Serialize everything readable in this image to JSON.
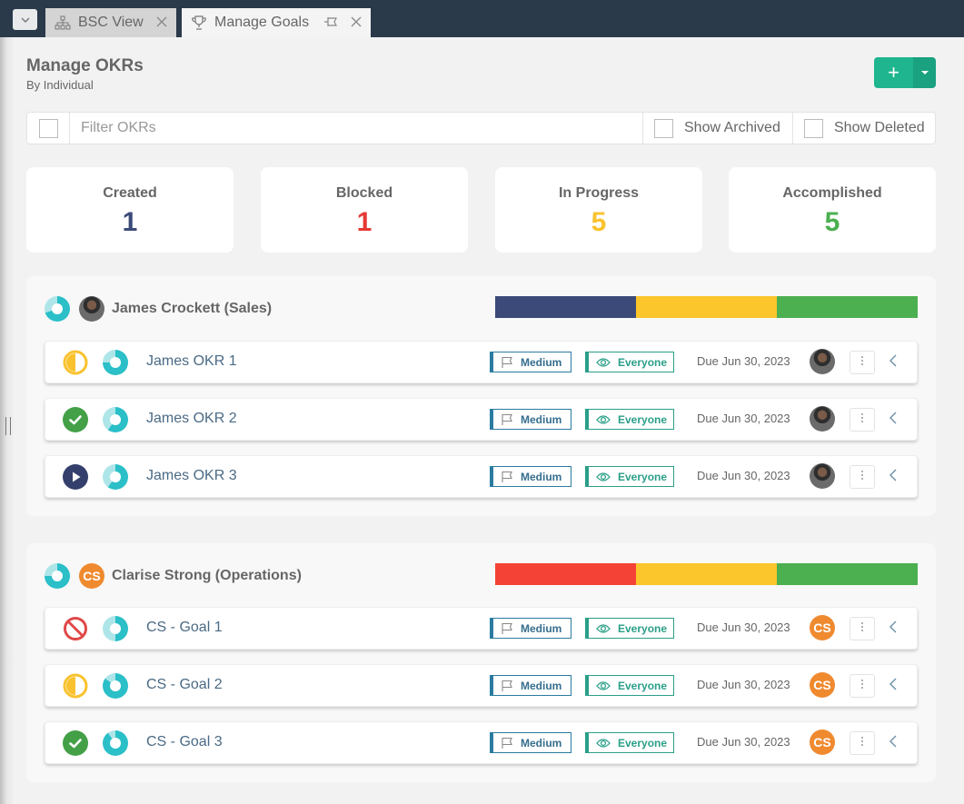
{
  "tabs": [
    {
      "label": "BSC View",
      "icon": "org-chart-icon",
      "active": false
    },
    {
      "label": "Manage Goals",
      "icon": "trophy-icon",
      "active": true
    }
  ],
  "header": {
    "title": "Manage OKRs",
    "subtitle": "By Individual",
    "add_label": "+"
  },
  "filter": {
    "placeholder": "Filter OKRs",
    "value": "",
    "show_archived_label": "Show Archived",
    "show_deleted_label": "Show Deleted"
  },
  "colors": {
    "created": "#3b4a78",
    "blocked": "#e53935",
    "in_progress": "#f9c22e",
    "accomplished": "#4caf50",
    "accent": "#1fb58e",
    "ring": "#2bbfc8",
    "ring_light": "#aee5e8"
  },
  "stats": [
    {
      "label": "Created",
      "value": "1",
      "color": "#3b4a78"
    },
    {
      "label": "Blocked",
      "value": "1",
      "color": "#e53935"
    },
    {
      "label": "In Progress",
      "value": "5",
      "color": "#f9c22e"
    },
    {
      "label": "Accomplished",
      "value": "5",
      "color": "#4caf50"
    }
  ],
  "groups": [
    {
      "name": "James Crockett (Sales)",
      "avatar_type": "photo",
      "avatar_initials": "",
      "progress_fraction": 0.7,
      "status_bar": [
        {
          "status": "created",
          "fraction": 0.3333,
          "color": "#3b4a78"
        },
        {
          "status": "in_progress",
          "fraction": 0.3333,
          "color": "#fbc52c"
        },
        {
          "status": "accomplished",
          "fraction": 0.3334,
          "color": "#4caf50"
        }
      ],
      "goals": [
        {
          "name": "James OKR 1",
          "status": "in-progress",
          "progress_fraction": 0.75,
          "priority": "Medium",
          "visibility": "Everyone",
          "due": "Due Jun 30, 2023"
        },
        {
          "name": "James OKR 2",
          "status": "accomplished",
          "progress_fraction": 0.6,
          "priority": "Medium",
          "visibility": "Everyone",
          "due": "Due Jun 30, 2023"
        },
        {
          "name": "James OKR 3",
          "status": "created",
          "progress_fraction": 0.6,
          "priority": "Medium",
          "visibility": "Everyone",
          "due": "Due Jun 30, 2023"
        }
      ]
    },
    {
      "name": "Clarise Strong (Operations)",
      "avatar_type": "initials",
      "avatar_initials": "CS",
      "progress_fraction": 0.75,
      "status_bar": [
        {
          "status": "blocked",
          "fraction": 0.3333,
          "color": "#f44336"
        },
        {
          "status": "in_progress",
          "fraction": 0.3333,
          "color": "#fbc52c"
        },
        {
          "status": "accomplished",
          "fraction": 0.3334,
          "color": "#4caf50"
        }
      ],
      "goals": [
        {
          "name": "CS - Goal 1",
          "status": "blocked",
          "progress_fraction": 0.5,
          "priority": "Medium",
          "visibility": "Everyone",
          "due": "Due Jun 30, 2023"
        },
        {
          "name": "CS - Goal 2",
          "status": "in-progress",
          "progress_fraction": 0.85,
          "priority": "Medium",
          "visibility": "Everyone",
          "due": "Due Jun 30, 2023"
        },
        {
          "name": "CS - Goal 3",
          "status": "accomplished",
          "progress_fraction": 0.9,
          "priority": "Medium",
          "visibility": "Everyone",
          "due": "Due Jun 30, 2023"
        }
      ]
    }
  ]
}
